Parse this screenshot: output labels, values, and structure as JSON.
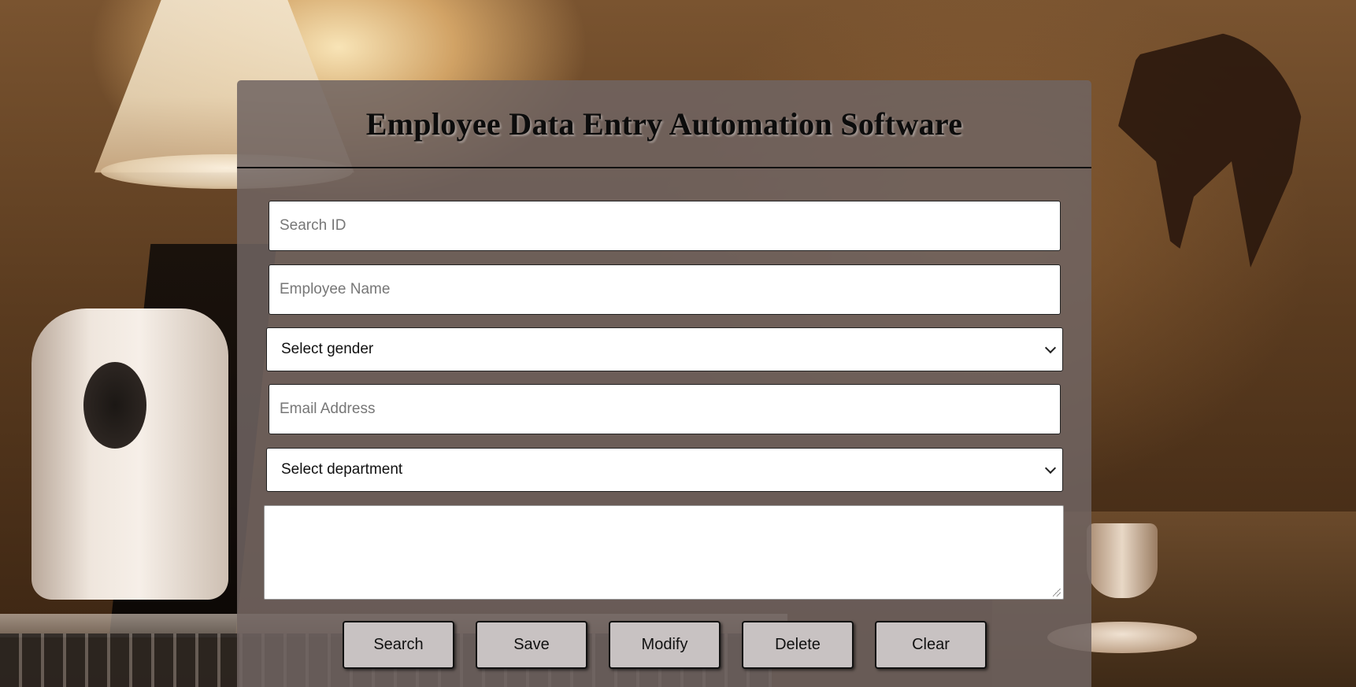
{
  "app": {
    "title": "Employee Data Entry Automation Software"
  },
  "form": {
    "search_id": {
      "placeholder": "Search ID",
      "value": ""
    },
    "employee_name": {
      "placeholder": "Employee Name",
      "value": ""
    },
    "gender": {
      "selected": "Select gender"
    },
    "email": {
      "placeholder": "Email Address",
      "value": ""
    },
    "department": {
      "selected": "Select department"
    },
    "notes": {
      "value": ""
    }
  },
  "buttons": {
    "search": "Search",
    "save": "Save",
    "modify": "Modify",
    "delete": "Delete",
    "clear": "Clear"
  }
}
